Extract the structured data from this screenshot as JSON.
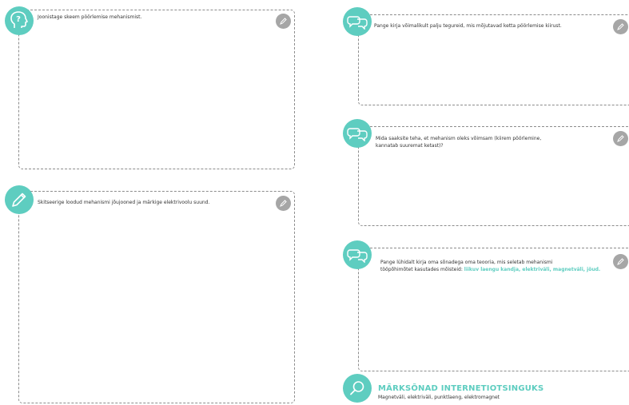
{
  "left_panels": [
    {
      "prompt": "Joonistage skeem pöörlemise mehanismist.",
      "icon": "question-head-icon"
    },
    {
      "prompt": "Skitseerige loodud mehanismi jõujooned ja märkige elektrivoolu suund.",
      "icon": "pencil-icon"
    }
  ],
  "right_panels": [
    {
      "prompt": "Pange kirja võimalikult palju tegureid, mis mõjutavad ketta pöörlemise kiirust.",
      "icon": "speech-bubbles-icon"
    },
    {
      "prompt_line1": "Mida saaksite teha, et mehanism oleks võimsam (kiirem pöörlemine,",
      "prompt_line2": "kannatab suuremat ketast)?",
      "icon": "speech-bubbles-icon"
    },
    {
      "prompt_line1": "Pange lühidalt kirja oma sõnadega oma teooria, mis seletab mehanismi",
      "prompt_line2_prefix": "tööpõhimõtet kasutades mõisteid: ",
      "prompt_line2_highlight": "liikuv laengu kandja, elektriväli, magnetväli, jõud.",
      "icon": "speech-bubbles-icon"
    }
  ],
  "keywords": {
    "title": "MÄRKSÕNAD INTERNETIOTSINGUKS",
    "text": "Magnetväli, elektriväli, punktlaeng, elektromagnet",
    "icon": "magnifier-icon"
  },
  "colors": {
    "accent": "#5ecdc0",
    "pencil_badge": "#a6a6a6",
    "border": "#8c8c8c"
  }
}
